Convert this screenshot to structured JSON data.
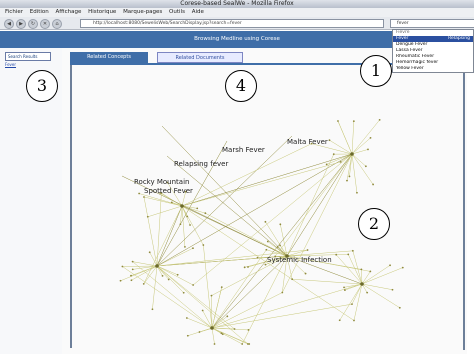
{
  "window": {
    "title": "Corese-based SealWe - Mozilla Firefox"
  },
  "menu": {
    "items": [
      "Fichier",
      "Edition",
      "Affichage",
      "Historique",
      "Marque-pages",
      "Outils",
      "Aide"
    ]
  },
  "toolbar": {
    "url": "http://localhost:8080/SewelisWeb/SearchDisplay.jsp?search=fever",
    "search_value": "fever"
  },
  "dropdown": {
    "header": "Fievre",
    "items": [
      "Fever",
      "Dengue Fever",
      "Lassa Fever",
      "Rheumatic Fever",
      "Hemorrhagic fever",
      "Yellow Fever"
    ],
    "selected_index": 0,
    "selected_badge": "Relapsing"
  },
  "banner": {
    "text": "Browsing Medline using Corese"
  },
  "left": {
    "tab_label": "Search Results",
    "link": "Fever"
  },
  "tabs": {
    "concepts": "Related Concepts",
    "documents": "Related Documents"
  },
  "graph": {
    "labels_large": [
      {
        "text": "Malta Fever"
      },
      {
        "text": "Marsh Fever"
      },
      {
        "text": "Relapsing fever"
      },
      {
        "text": "Rocky Mountain Spotted Fever"
      },
      {
        "text": "Systemic Infection"
      }
    ]
  },
  "callouts": [
    "1",
    "2",
    "3",
    "4"
  ],
  "colors": {
    "banner": "#3f6ea8",
    "edge": "#c8c87a",
    "edge_dark": "#8f8a3c"
  }
}
